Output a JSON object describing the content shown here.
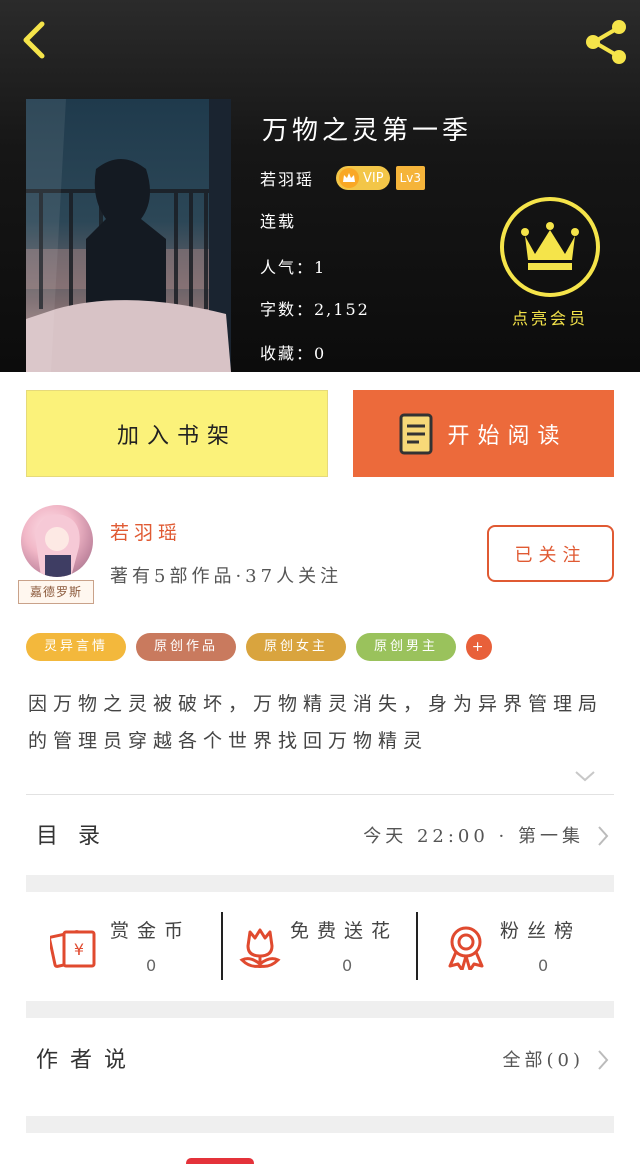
{
  "header": {
    "title": "万物之灵第一季",
    "author": "若羽瑶",
    "vip_label": "VIP",
    "level_label": "Lv3",
    "status": "连载",
    "popularity": "人气：1",
    "word_count": "字数：2,152",
    "collections": "收藏：0",
    "member_label": "点亮会员",
    "accent_color": "#f5e44a"
  },
  "actions": {
    "add_shelf": "加入书架",
    "start_read": "开始阅读"
  },
  "author": {
    "name": "若羽瑶",
    "avatar_caption": "嘉德罗斯",
    "stats": "著有5部作品·37人关注",
    "follow_label": "已关注"
  },
  "tags": [
    {
      "label": "灵异言情",
      "color": "#f3b83c"
    },
    {
      "label": "原创作品",
      "color": "#c97a5e"
    },
    {
      "label": "原创女主",
      "color": "#d9a43e"
    },
    {
      "label": "原创男主",
      "color": "#9ac25c"
    }
  ],
  "tag_more": "+",
  "description": "因万物之灵被破坏，万物精灵消失，身为异界管理局的管理员穿越各个世界找回万物精灵",
  "toc": {
    "label": "目录",
    "latest": "今天 22:00 · 第一集"
  },
  "rewards": [
    {
      "label": "赏金币",
      "value": "0",
      "icon": "red-envelope-icon"
    },
    {
      "label": "免费送花",
      "value": "0",
      "icon": "flower-icon"
    },
    {
      "label": "粉丝榜",
      "value": "0",
      "icon": "medal-icon"
    }
  ],
  "author_says": {
    "label": "作者说",
    "all": "全部(0)"
  }
}
